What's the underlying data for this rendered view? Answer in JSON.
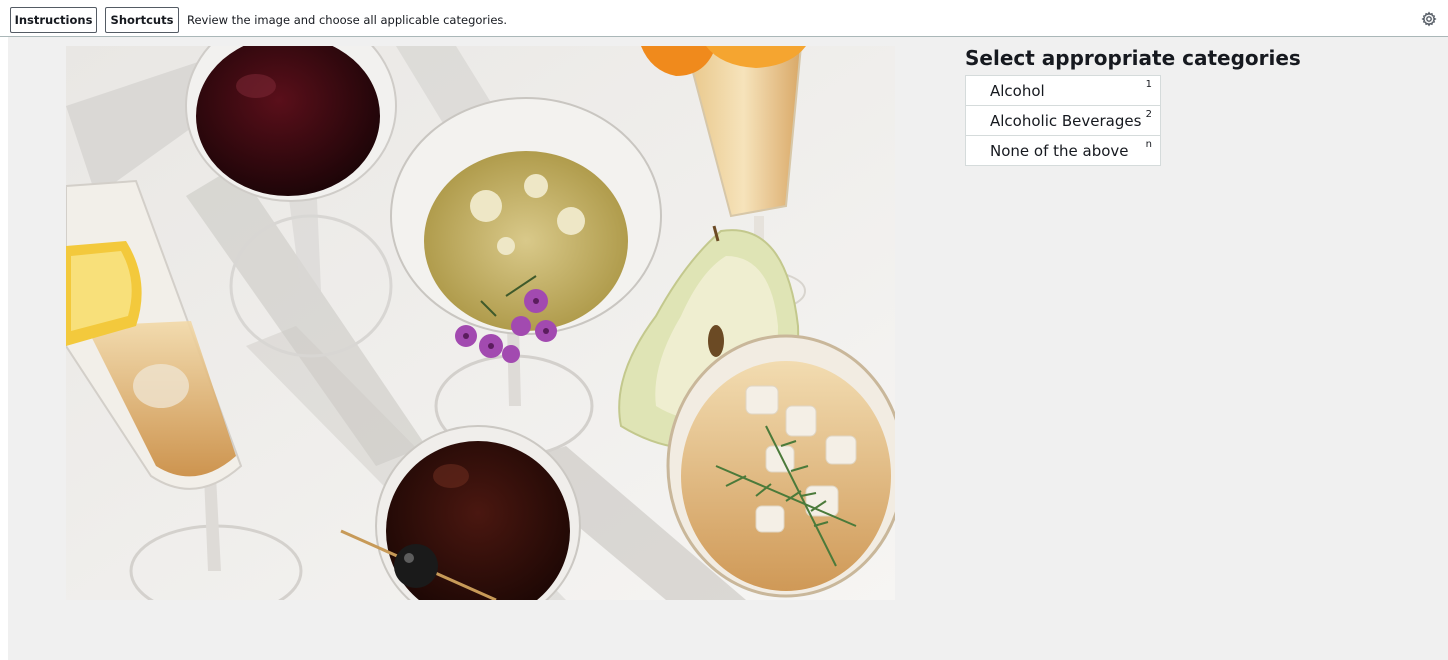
{
  "toolbar": {
    "instructions_label": "Instructions",
    "shortcuts_label": "Shortcuts",
    "prompt": "Review the image and choose all applicable categories.",
    "settings_icon": "gear-icon"
  },
  "image": {
    "subject": "cocktails"
  },
  "categories": {
    "title": "Select appropriate categories",
    "items": [
      {
        "label": "Alcohol",
        "shortcut": "1"
      },
      {
        "label": "Alcoholic Beverages",
        "shortcut": "2"
      },
      {
        "label": "None of the above",
        "shortcut": "n"
      }
    ]
  },
  "colors": {
    "workspace_bg": "#f0f0f0",
    "toolbar_bg": "#ffffff",
    "border": "#545b64"
  }
}
